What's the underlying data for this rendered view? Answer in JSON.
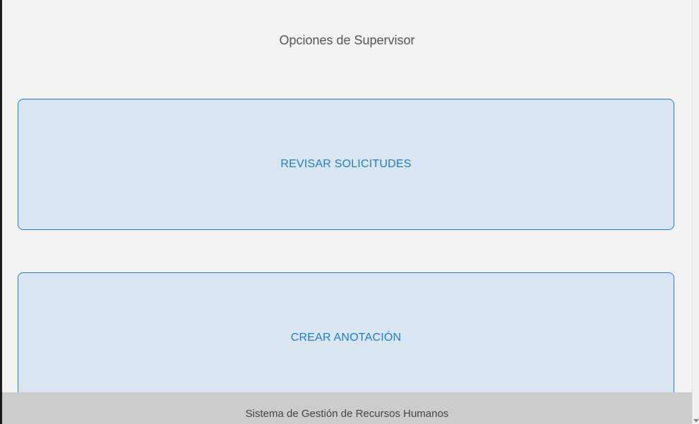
{
  "page": {
    "title": "Opciones de Supervisor"
  },
  "options": [
    {
      "label": "REVISAR SOLICITUDES"
    },
    {
      "label": "CREAR ANOTACIÓN"
    }
  ],
  "footer": {
    "text": "Sistema de Gestión de Recursos Humanos"
  },
  "colors": {
    "background": "#f2f2f2",
    "card_background": "#d9e5f1",
    "accent": "#1e7bd4",
    "footer_background": "#cccccc"
  }
}
